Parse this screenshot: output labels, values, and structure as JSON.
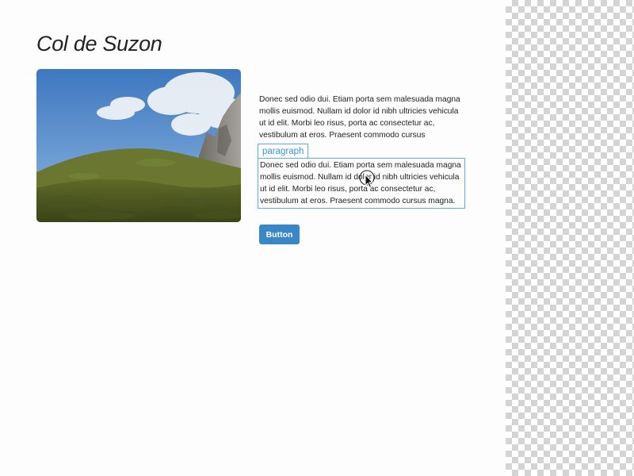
{
  "page": {
    "title": "Col de Suzon"
  },
  "image": {
    "icon": "landscape-photo",
    "description_colors": {
      "sky": "#5b8fc9",
      "cloud": "#eef2f6",
      "grass": "#5a6524",
      "rock": "#8b8a84"
    }
  },
  "content": {
    "paragraph_1": "Donec sed odio dui. Etiam porta sem malesuada magna mollis euismod. Nullam id dolor id nibh ultricies vehicula ut id elit. Morbi leo risus, porta ac consectetur ac, vestibulum at eros. Praesent commodo cursus",
    "selected_tag_label": "paragraph",
    "paragraph_2": "Donec sed odio dui. Etiam porta sem malesuada magna mollis euismod. Nullam id dolor id nibh ultricies vehicula ut id elit. Morbi leo risus, porta ac consectetur ac, vestibulum at eros. Praesent commodo cursus magna.",
    "button_label": "Button"
  },
  "colors": {
    "selection_outline": "#5aaee0",
    "button_background": "#3a87c8",
    "text": "#222222"
  },
  "cursor": {
    "icon": "pointer-cursor-icon"
  }
}
